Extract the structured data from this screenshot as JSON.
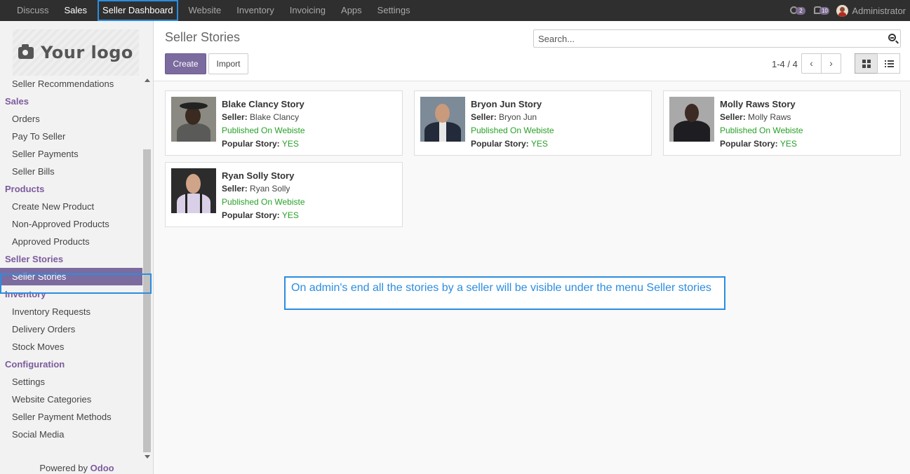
{
  "topbar": {
    "menu": [
      "Discuss",
      "Sales",
      "Seller Dashboard",
      "Website",
      "Inventory",
      "Invoicing",
      "Apps",
      "Settings"
    ],
    "activity_badge": "2",
    "message_badge": "10",
    "user": "Administrator"
  },
  "sidebar": {
    "logo_text": "Your logo",
    "sections": [
      {
        "items": [
          "Seller Recommendations"
        ]
      },
      {
        "title": "Sales",
        "items": [
          "Orders",
          "Pay To Seller",
          "Seller Payments",
          "Seller Bills"
        ]
      },
      {
        "title": "Products",
        "items": [
          "Create New Product",
          "Non-Approved Products",
          "Approved Products"
        ]
      },
      {
        "title": "Seller Stories",
        "items": [
          "Seller Stories"
        ]
      },
      {
        "title": "Inventory",
        "items": [
          "Inventory Requests",
          "Delivery Orders",
          "Stock Moves"
        ]
      },
      {
        "title": "Configuration",
        "items": [
          "Settings",
          "Website Categories",
          "Seller Payment Methods",
          "Social Media"
        ]
      }
    ],
    "powered_prefix": "Powered by",
    "powered_brand": "Odoo"
  },
  "control_panel": {
    "title": "Seller Stories",
    "create_label": "Create",
    "import_label": "Import",
    "search_placeholder": "Search...",
    "pager": "1-4 / 4"
  },
  "cards": [
    {
      "name": "Blake Clancy Story",
      "seller_label": "Seller:",
      "seller": "Blake Clancy",
      "published": "Published On Webiste",
      "popular_label": "Popular Story:",
      "popular": "YES"
    },
    {
      "name": "Bryon Jun Story",
      "seller_label": "Seller:",
      "seller": "Bryon Jun",
      "published": "Published On Webiste",
      "popular_label": "Popular Story:",
      "popular": "YES"
    },
    {
      "name": "Molly Raws Story",
      "seller_label": "Seller:",
      "seller": "Molly Raws",
      "published": "Published On Webiste",
      "popular_label": "Popular Story:",
      "popular": "YES"
    },
    {
      "name": "Ryan Solly Story",
      "seller_label": "Seller:",
      "seller": "Ryan Solly",
      "published": "Published On Webiste",
      "popular_label": "Popular Story:",
      "popular": "YES"
    }
  ],
  "annotation": "On admin's end all the stories by a seller will be visible under the menu Seller stories",
  "colors": {
    "brand": "#7c6b9f",
    "highlight": "#2b8de0",
    "success": "#28a028",
    "topbar": "#2f2f2f"
  }
}
